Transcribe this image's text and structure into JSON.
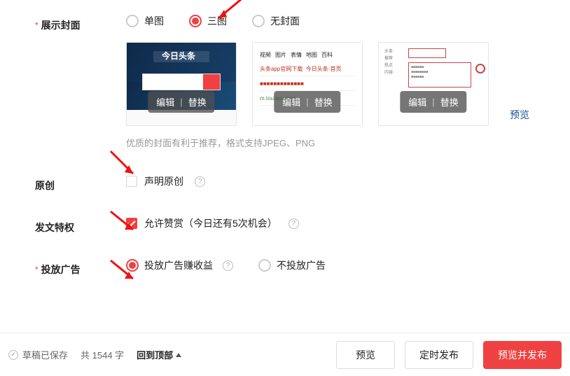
{
  "cover": {
    "label": "展示封面",
    "options": {
      "single": "单图",
      "triple": "三图",
      "none": "无封面"
    },
    "overlay": {
      "edit": "编辑",
      "replace": "替换"
    },
    "previewLink": "预览",
    "helpText": "优质的封面有利于推荐，格式支持JPEG、PNG",
    "thumb1Title": "今日头条"
  },
  "original": {
    "label": "原创",
    "checkboxLabel": "声明原创"
  },
  "privilege": {
    "label": "发文特权",
    "checkboxLabel": "允许赞赏（今日还有5次机会）"
  },
  "ad": {
    "label": "投放广告",
    "options": {
      "enable": "投放广告赚收益",
      "disable": "不投放广告"
    }
  },
  "footer": {
    "saved": "草稿已保存",
    "wordCount": "共 1544 字",
    "backTop": "回到顶部",
    "preview": "预览",
    "schedule": "定时发布",
    "publish": "预览并发布"
  }
}
